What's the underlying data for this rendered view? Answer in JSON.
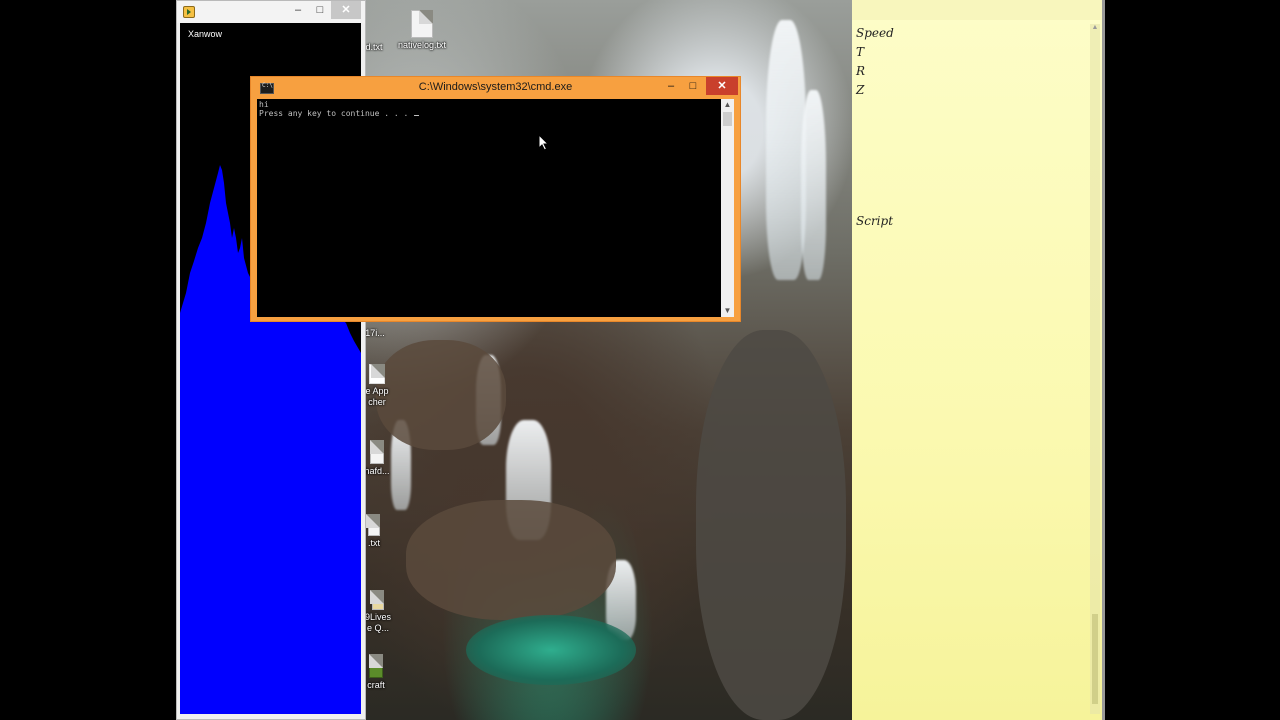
{
  "desktop": {
    "icons": [
      {
        "label": "nativelog.txt"
      },
      {
        "label": "d.txt"
      },
      {
        "label": "17i..."
      },
      {
        "label": "e App"
      },
      {
        "label": "cher"
      },
      {
        "label": "hafd..."
      },
      {
        "label": ".txt"
      },
      {
        "label": "9Lives"
      },
      {
        "label": "e Q..."
      },
      {
        "label": "craft"
      }
    ]
  },
  "xanwow_window": {
    "caption": "Xanwow",
    "minimize_glyph": "–",
    "maximize_glyph": "□",
    "close_glyph": "✕",
    "graph_color": "#0000ff"
  },
  "cmd_window": {
    "title": "C:\\Windows\\system32\\cmd.exe",
    "minimize_glyph": "–",
    "maximize_glyph": "□",
    "close_glyph": "✕",
    "output_lines": [
      "hi",
      "Press any key to continue . . . "
    ],
    "frame_color": "#f7a040",
    "scroll_up_glyph": "▲",
    "scroll_down_glyph": "▼"
  },
  "sticky_note": {
    "lines": [
      "Speed",
      "T",
      "R",
      "Z",
      "Script"
    ],
    "background": "#fbf9b0"
  }
}
